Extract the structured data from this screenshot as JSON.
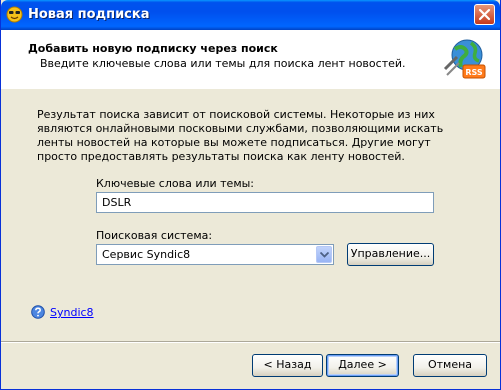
{
  "window": {
    "title": "Новая подписка"
  },
  "header": {
    "title": "Добавить новую подписку через поиск",
    "subtitle": "Введите ключевые слова или темы для поиска лент новостей.",
    "rss_badge": "RSS"
  },
  "body": {
    "description": "Результат поиска зависит от поисковой системы. Некоторые из них являются онлайновыми посковыми службами, позволяющими искать ленты новостей на которые вы можете подписаться. Другие могут просто предоставлять результаты поиска как ленту новостей.",
    "keywords_label": "Ключевые слова или темы:",
    "keywords_value": "DSLR",
    "engine_label": "Поисковая система:",
    "engine_selected": "Сервис Syndic8",
    "manage_button": "Управление..."
  },
  "help": {
    "link_text": "Syndic8"
  },
  "footer": {
    "back_button": "< Назад",
    "next_button": "Далее >",
    "cancel_button": "Отмена"
  },
  "icons": {
    "app": "smiley-rss-icon",
    "header": "globe-rss-icon",
    "help": "question-icon",
    "close": "close-icon",
    "dropdown": "chevron-down-icon"
  }
}
